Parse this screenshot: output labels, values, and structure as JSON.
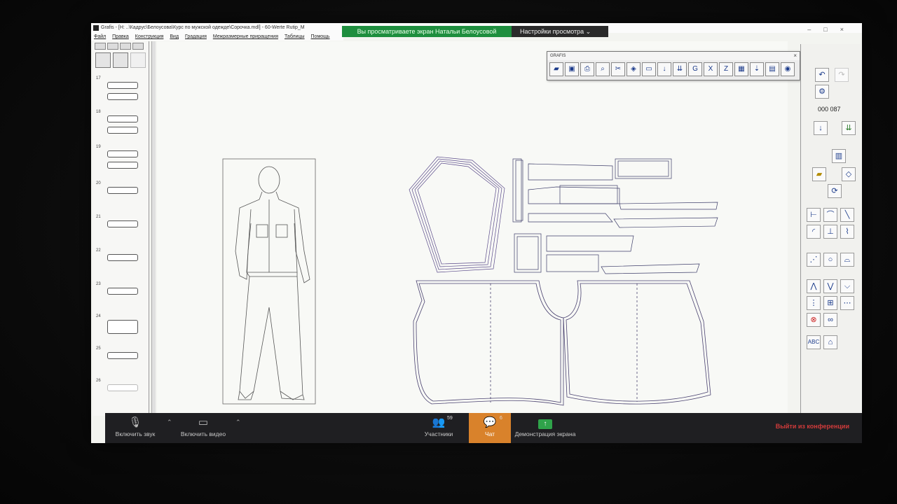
{
  "window": {
    "title": "Grafis - [H: ..\\Кадрус\\Белоусова\\Курс по мужской одежде\\Сорочка.mdl] - 60-Werte Rutip_M",
    "menu": [
      "Файл",
      "Правка",
      "Конструкция",
      "Вид",
      "Градация",
      "Межразмерные приращения",
      "Таблицы",
      "Помощь"
    ]
  },
  "share_banner": {
    "viewing_text": "Вы просматриваете экран Натальи Белоусовой",
    "view_options": "Настройки просмотра"
  },
  "left_panel": {
    "rows": [
      {
        "num": "17"
      },
      {
        "num": "18"
      },
      {
        "num": "19"
      },
      {
        "num": "20"
      },
      {
        "num": "21"
      },
      {
        "num": "22"
      },
      {
        "num": "23"
      },
      {
        "num": "24"
      },
      {
        "num": "25"
      },
      {
        "num": "26"
      }
    ]
  },
  "grafis_toolbar": {
    "caption": "GRAFIS",
    "tool_icons": [
      "open-icon",
      "save-icon",
      "print-icon",
      "zoom-icon",
      "cut-icon",
      "piece-icon",
      "ruler-icon",
      "arrow-down-icon",
      "double-arrow-down-icon",
      "grade-icon",
      "x-icon",
      "z-icon",
      "table-icon",
      "import-icon",
      "calculator-icon",
      "settings-icon"
    ]
  },
  "right_toolbar": {
    "counter": "000 087",
    "abc_label": "ABC"
  },
  "zoom_bar": {
    "unmute_label": "Включить звук",
    "start_video_label": "Включить видео",
    "participants_label": "Участники",
    "participants_count": "59",
    "chat_label": "Чат",
    "chat_count": "6",
    "share_label": "Демонстрация экрана",
    "leave_label": "Выйти из конференции"
  },
  "colors": {
    "zoom_green": "#1e8e3e",
    "chat_orange": "#d9822b",
    "leave_red": "#d13b3b"
  }
}
